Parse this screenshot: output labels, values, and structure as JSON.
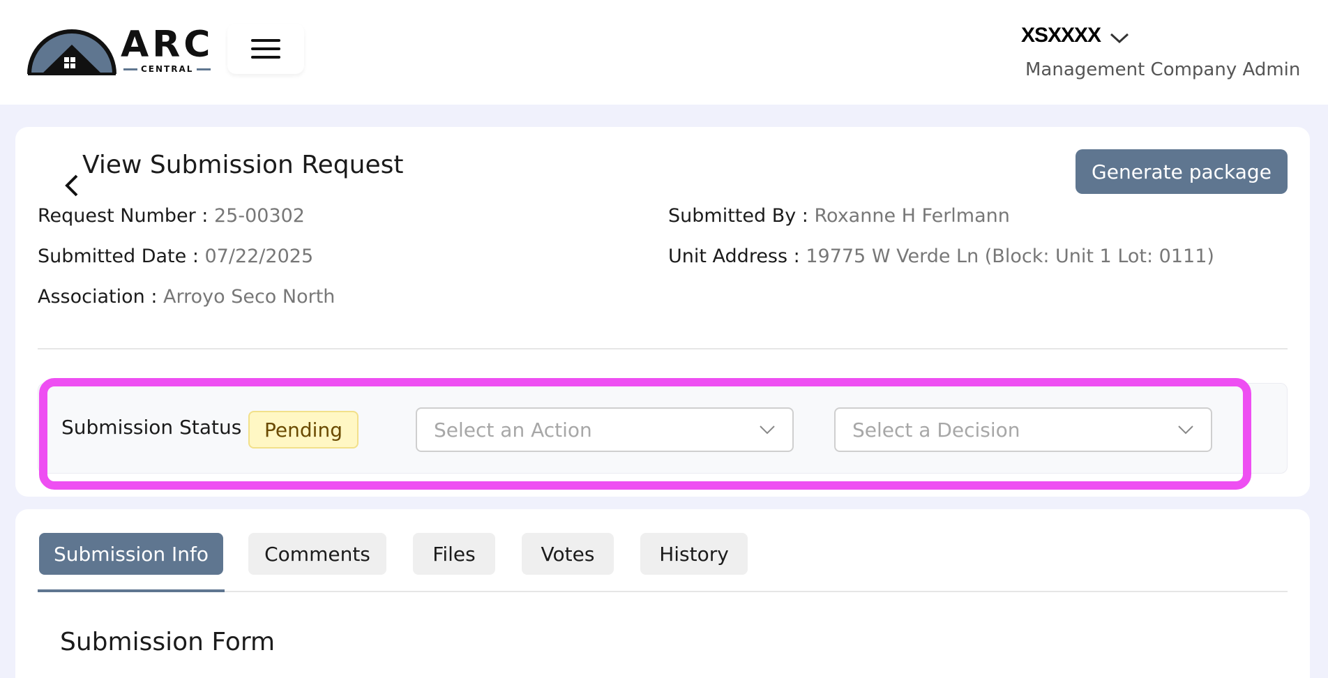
{
  "header": {
    "logo_title": "ARC",
    "logo_subtitle": "CENTRAL",
    "user_name": "XSXXXX",
    "user_role": "Management Company Admin"
  },
  "details": {
    "page_title": "View Submission Request",
    "generate_button": "Generate package",
    "fields": {
      "request_number": {
        "label": "Request Number : ",
        "value": "25-00302"
      },
      "submitted_date": {
        "label": "Submitted Date : ",
        "value": "07/22/2025"
      },
      "association": {
        "label": "Association : ",
        "value": "Arroyo Seco North"
      },
      "submitted_by": {
        "label": "Submitted By : ",
        "value": "Roxanne H Ferlmann"
      },
      "unit_address": {
        "label": "Unit Address : ",
        "value": "19775 W Verde Ln (Block: Unit 1 Lot: 0111)"
      }
    }
  },
  "status": {
    "label": "Submission Status :",
    "badge": "Pending",
    "action_placeholder": "Select an Action",
    "decision_placeholder": "Select a Decision"
  },
  "tabs": [
    {
      "label": "Submission Info",
      "active": true
    },
    {
      "label": "Comments",
      "active": false
    },
    {
      "label": "Files",
      "active": false
    },
    {
      "label": "Votes",
      "active": false
    },
    {
      "label": "History",
      "active": false
    }
  ],
  "section": {
    "title": "Submission Form"
  },
  "colors": {
    "accent": "#5f7690",
    "highlight": "#ee4ff2",
    "pending_bg": "#fff7c4",
    "page_bg": "#f0f1fc"
  }
}
